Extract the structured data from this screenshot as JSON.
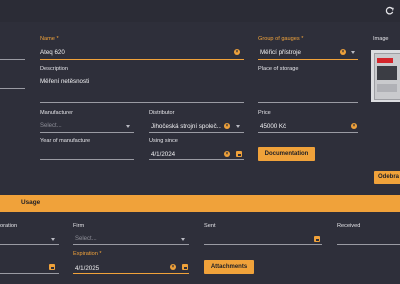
{
  "toolbar": {
    "refresh_icon": "refresh-icon"
  },
  "form": {
    "name": {
      "label": "Name *",
      "value": "Ateq 620"
    },
    "group": {
      "label": "Group of gauges *",
      "value": "Měřicí přístroje"
    },
    "image": {
      "label": "Image"
    },
    "description": {
      "label": "Description",
      "value": "Měření netěsnosti"
    },
    "place_of_storage": {
      "label": "Place of storage",
      "value": ""
    },
    "manufacturer": {
      "label": "Manufacturer",
      "placeholder": "Select..."
    },
    "distributor": {
      "label": "Distributor",
      "value": "Jihočeská strojní společ..."
    },
    "price": {
      "label": "Price",
      "value": "45000 Kč"
    },
    "year_of_manufacture": {
      "label": "Year of manufacture",
      "value": ""
    },
    "using_since": {
      "label": "Using since",
      "value": "4/1/2024"
    },
    "documentation_button": "Documentation",
    "remove_button": "Odebra"
  },
  "usage": {
    "title": "Usage",
    "calibration": {
      "label": "oration"
    },
    "firm": {
      "label": "Firm",
      "placeholder": "Select..."
    },
    "sent": {
      "label": "Sent",
      "value": ""
    },
    "received": {
      "label": "Received",
      "value": ""
    },
    "expiration": {
      "label": "Expiration *",
      "value": "4/1/2025"
    },
    "attachments_button": "Attachments"
  },
  "colors": {
    "accent": "#f0a23a",
    "background": "#2e2f3a"
  }
}
